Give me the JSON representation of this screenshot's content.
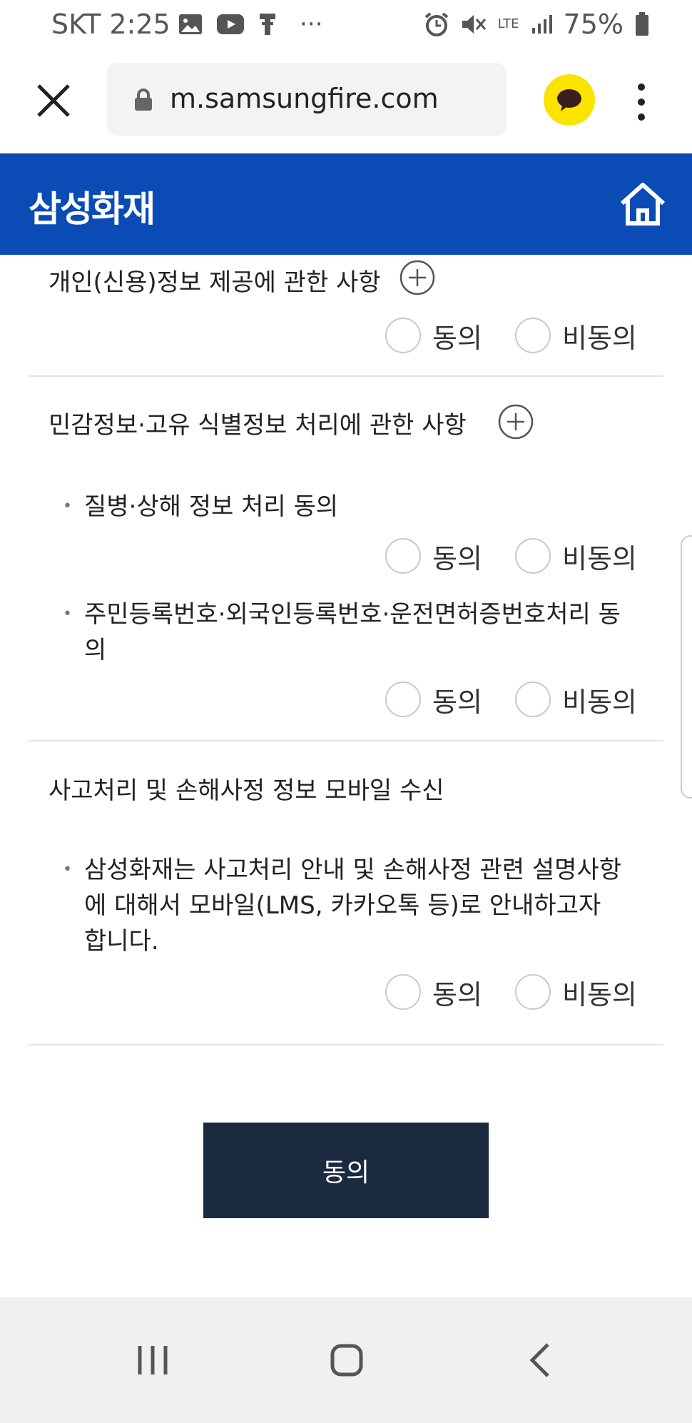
{
  "status_bar": {
    "carrier_time": "SKT 2:25",
    "overflow": "···",
    "network": "LTE",
    "battery": "75%",
    "icons": [
      "image-icon",
      "youtube-icon",
      "usb-icon",
      "alarm-icon",
      "mute-icon",
      "signal-icon",
      "battery-icon"
    ]
  },
  "browser": {
    "url": "m.samsungfire.com",
    "icons": [
      "close-icon",
      "lock-icon",
      "kakaotalk-icon",
      "more-vert-icon"
    ]
  },
  "header": {
    "brand": "삼성화재",
    "bg_color": "#0a4bb5",
    "home_icon": "home-icon"
  },
  "sections": {
    "personal_info": {
      "title": "개인(신용)정보 제공에 관한 사항",
      "agree": "동의",
      "disagree": "비동의"
    },
    "sensitive_info": {
      "title": "민감정보·고유 식별정보 처리에 관한 사항",
      "items": [
        {
          "text": "질병·상해 정보 처리 동의",
          "agree": "동의",
          "disagree": "비동의"
        },
        {
          "text": "주민등록번호·외국인등록번호·운전면허증번호처리 동의",
          "agree": "동의",
          "disagree": "비동의"
        }
      ]
    },
    "mobile_receive": {
      "title": "사고처리 및 손해사정 정보 모바일 수신",
      "items": [
        {
          "text": "삼성화재는 사고처리 안내 및 손해사정 관련 설명사항에 대해서 모바일(LMS, 카카오톡 등)로 안내하고자 합니다.",
          "agree": "동의",
          "disagree": "비동의"
        }
      ]
    }
  },
  "submit": {
    "label": "동의",
    "color": "#1b2a3f"
  },
  "nav": {
    "icons": [
      "recent-apps-icon",
      "home-nav-icon",
      "back-icon"
    ]
  }
}
